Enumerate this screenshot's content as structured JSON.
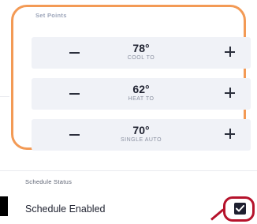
{
  "setpoints": {
    "title": "Set Points",
    "rows": [
      {
        "value": "78°",
        "label": "COOL TO"
      },
      {
        "value": "62°",
        "label": "HEAT TO"
      },
      {
        "value": "70°",
        "label": "SINGLE AUTO"
      }
    ]
  },
  "schedule": {
    "section_title": "Schedule Status",
    "label": "Schedule Enabled",
    "enabled": true
  },
  "colors": {
    "highlight_orange": "#f39a55",
    "highlight_red": "#b5122b",
    "row_background": "#f0f2f7",
    "checkbox_fill": "#1e2030"
  }
}
